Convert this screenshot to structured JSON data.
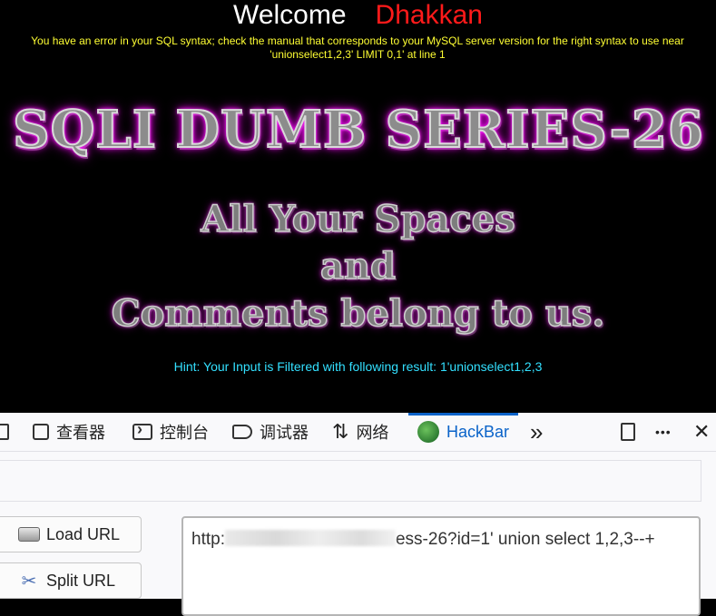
{
  "page": {
    "welcome_word": "Welcome",
    "user_name": "Dhakkan",
    "sql_error": "You have an error in your SQL syntax; check the manual that corresponds to your MySQL server version for the right syntax to use near 'unionselect1,2,3' LIMIT 0,1' at line 1",
    "banner": "SQLI DUMB SERIES-26",
    "tagline_lines": [
      "All Your Spaces",
      "and",
      "Comments belong to us."
    ],
    "hint": "Hint: Your Input is Filtered with following result: 1'unionselect1,2,3"
  },
  "devtools": {
    "tabs": [
      {
        "label": "查看器",
        "icon": "inspector-icon"
      },
      {
        "label": "控制台",
        "icon": "console-icon"
      },
      {
        "label": "调试器",
        "icon": "debugger-icon"
      },
      {
        "label": "网络",
        "icon": "network-icon"
      },
      {
        "label": "HackBar",
        "icon": "hackbar-icon",
        "active": true
      }
    ],
    "overflow": "»",
    "right_icons": [
      "responsive-design-icon",
      "more-options-icon",
      "close-icon"
    ],
    "more_glyph": "•••",
    "close_glyph": "✕"
  },
  "hackbar": {
    "load_url_label": "Load URL",
    "split_url_label": "Split URL",
    "url_prefix": "http:",
    "url_suffix": "ess-26?id=1' union select 1,2,3--+"
  },
  "colors": {
    "welcome": "#ffffff",
    "user_name": "#ff1a1a",
    "sql_error": "#ffff33",
    "hint": "#33e0ff",
    "banner_glow": "#ff00ff",
    "active_tab": "#0a63c9"
  }
}
